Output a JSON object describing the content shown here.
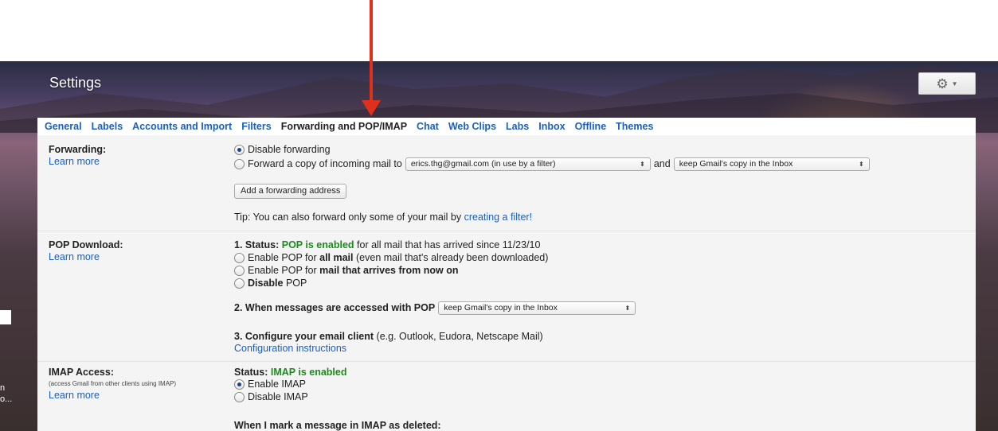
{
  "header": {
    "title": "Settings",
    "gear_icon": "gear-icon",
    "caret_icon": "chevron-down-icon"
  },
  "left_edge": {
    "line1": "n",
    "line2": "o..."
  },
  "tabs": [
    {
      "label": "General"
    },
    {
      "label": "Labels"
    },
    {
      "label": "Accounts and Import"
    },
    {
      "label": "Filters"
    },
    {
      "label": "Forwarding and POP/IMAP",
      "active": true
    },
    {
      "label": "Chat"
    },
    {
      "label": "Web Clips"
    },
    {
      "label": "Labs"
    },
    {
      "label": "Inbox"
    },
    {
      "label": "Offline"
    },
    {
      "label": "Themes"
    }
  ],
  "forwarding": {
    "label": "Forwarding:",
    "learn_more": "Learn more",
    "disable": "Disable forwarding",
    "forward_copy": "Forward a copy of incoming mail to",
    "address_select": "erics.thg@gmail.com (in use by a filter)",
    "and": "and",
    "keep_select": "keep Gmail's copy in the Inbox",
    "add_button": "Add a forwarding address",
    "tip_prefix": "Tip: You can also forward only some of your mail by",
    "tip_link": "creating a filter!"
  },
  "pop": {
    "label": "POP Download:",
    "learn_more": "Learn more",
    "status_prefix": "1. Status:",
    "status_value": "POP is enabled",
    "status_suffix": "for all mail that has arrived since 11/23/10",
    "opt1_a": "Enable POP for",
    "opt1_b": "all mail",
    "opt1_c": "(even mail that's already been downloaded)",
    "opt2_a": "Enable POP for",
    "opt2_b": "mail that arrives from now on",
    "opt3_a": "Disable",
    "opt3_b": "POP",
    "when_label": "2. When messages are accessed with POP",
    "when_select": "keep Gmail's copy in the Inbox",
    "configure_bold": "3. Configure your email client",
    "configure_rest": "(e.g. Outlook, Eudora, Netscape Mail)",
    "config_link": "Configuration instructions"
  },
  "imap": {
    "label": "IMAP Access:",
    "sub": "(access Gmail from other clients using IMAP)",
    "learn_more": "Learn more",
    "status_prefix": "Status:",
    "status_value": "IMAP is enabled",
    "enable": "Enable IMAP",
    "disable": "Disable IMAP",
    "deleted_heading": "When I mark a message in IMAP as deleted:"
  },
  "colors": {
    "link": "#1a5fc1",
    "enabled_green": "#1e8a1e",
    "annotation_arrow": "#e0301c"
  }
}
